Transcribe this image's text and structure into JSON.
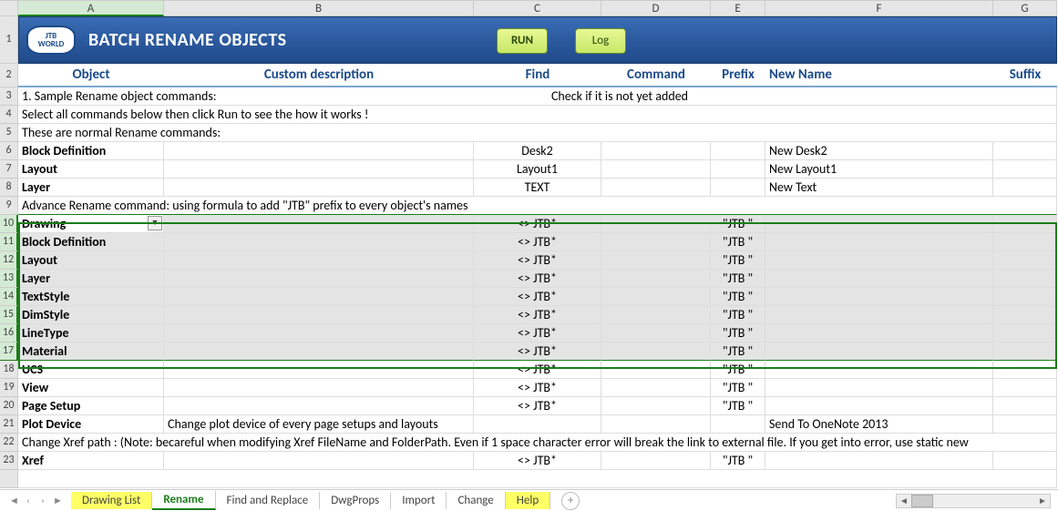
{
  "columns": [
    "A",
    "B",
    "C",
    "D",
    "E",
    "F",
    "G"
  ],
  "banner": {
    "logo_top": "JTB",
    "logo_bot": "WORLD",
    "title": "BATCH RENAME OBJECTS",
    "run": "RUN",
    "log": "Log"
  },
  "headers": {
    "object": "Object",
    "custom": "Custom description",
    "find": "Find",
    "command": "Command",
    "prefix": "Prefix",
    "newname": "New Name",
    "suffix": "Suffix"
  },
  "rows": {
    "r3": {
      "a": "1. Sample Rename object commands:",
      "note": "Check if it is not yet added"
    },
    "r4": {
      "a": "Select all commands below then click Run to see the how it works !"
    },
    "r5": {
      "a": "These are normal Rename commands:"
    },
    "r6": {
      "a": "Block Definition",
      "c": "Desk2",
      "f": "New Desk2"
    },
    "r7": {
      "a": "Layout",
      "c": "Layout1",
      "f": "New Layout1"
    },
    "r8": {
      "a": "Layer",
      "c": "TEXT",
      "f": "New Text"
    },
    "r9": {
      "a": "Advance Rename command: using formula to add \"JTB\" prefix to every object's names"
    },
    "r10": {
      "a": "Drawing",
      "c": "<> JTB*",
      "e": "\"JTB \""
    },
    "r11": {
      "a": "Block Definition",
      "c": "<> JTB*",
      "e": "\"JTB \""
    },
    "r12": {
      "a": "Layout",
      "c": "<> JTB*",
      "e": "\"JTB \""
    },
    "r13": {
      "a": "Layer",
      "c": "<> JTB*",
      "e": "\"JTB \""
    },
    "r14": {
      "a": "TextStyle",
      "c": "<> JTB*",
      "e": "\"JTB \""
    },
    "r15": {
      "a": "DimStyle",
      "c": "<> JTB*",
      "e": "\"JTB \""
    },
    "r16": {
      "a": "LineType",
      "c": "<> JTB*",
      "e": "\"JTB \""
    },
    "r17": {
      "a": "Material",
      "c": "<> JTB*",
      "e": "\"JTB \""
    },
    "r18": {
      "a": "UCS",
      "c": "<> JTB*",
      "e": "\"JTB \""
    },
    "r19": {
      "a": "View",
      "c": "<> JTB*",
      "e": "\"JTB \""
    },
    "r20": {
      "a": "Page Setup",
      "c": "<> JTB*",
      "e": "\"JTB \""
    },
    "r21": {
      "a": "Plot Device",
      "b": "Change plot device of every page setups and layouts",
      "f": "Send To OneNote 2013"
    },
    "r22": {
      "a": "Change Xref path : (Note: becareful when modifying Xref FileName and FolderPath. Even if 1 space character error will break the link to external file. If you get into error, use static new"
    },
    "r23": {
      "a": "Xref",
      "c": "<> JTB*",
      "e": "\"JTB \""
    }
  },
  "tabs": {
    "t1": "Drawing List",
    "t2": "Rename",
    "t3": "Find and Replace",
    "t4": "DwgProps",
    "t5": "Import",
    "t6": "Change",
    "t7": "Help"
  }
}
